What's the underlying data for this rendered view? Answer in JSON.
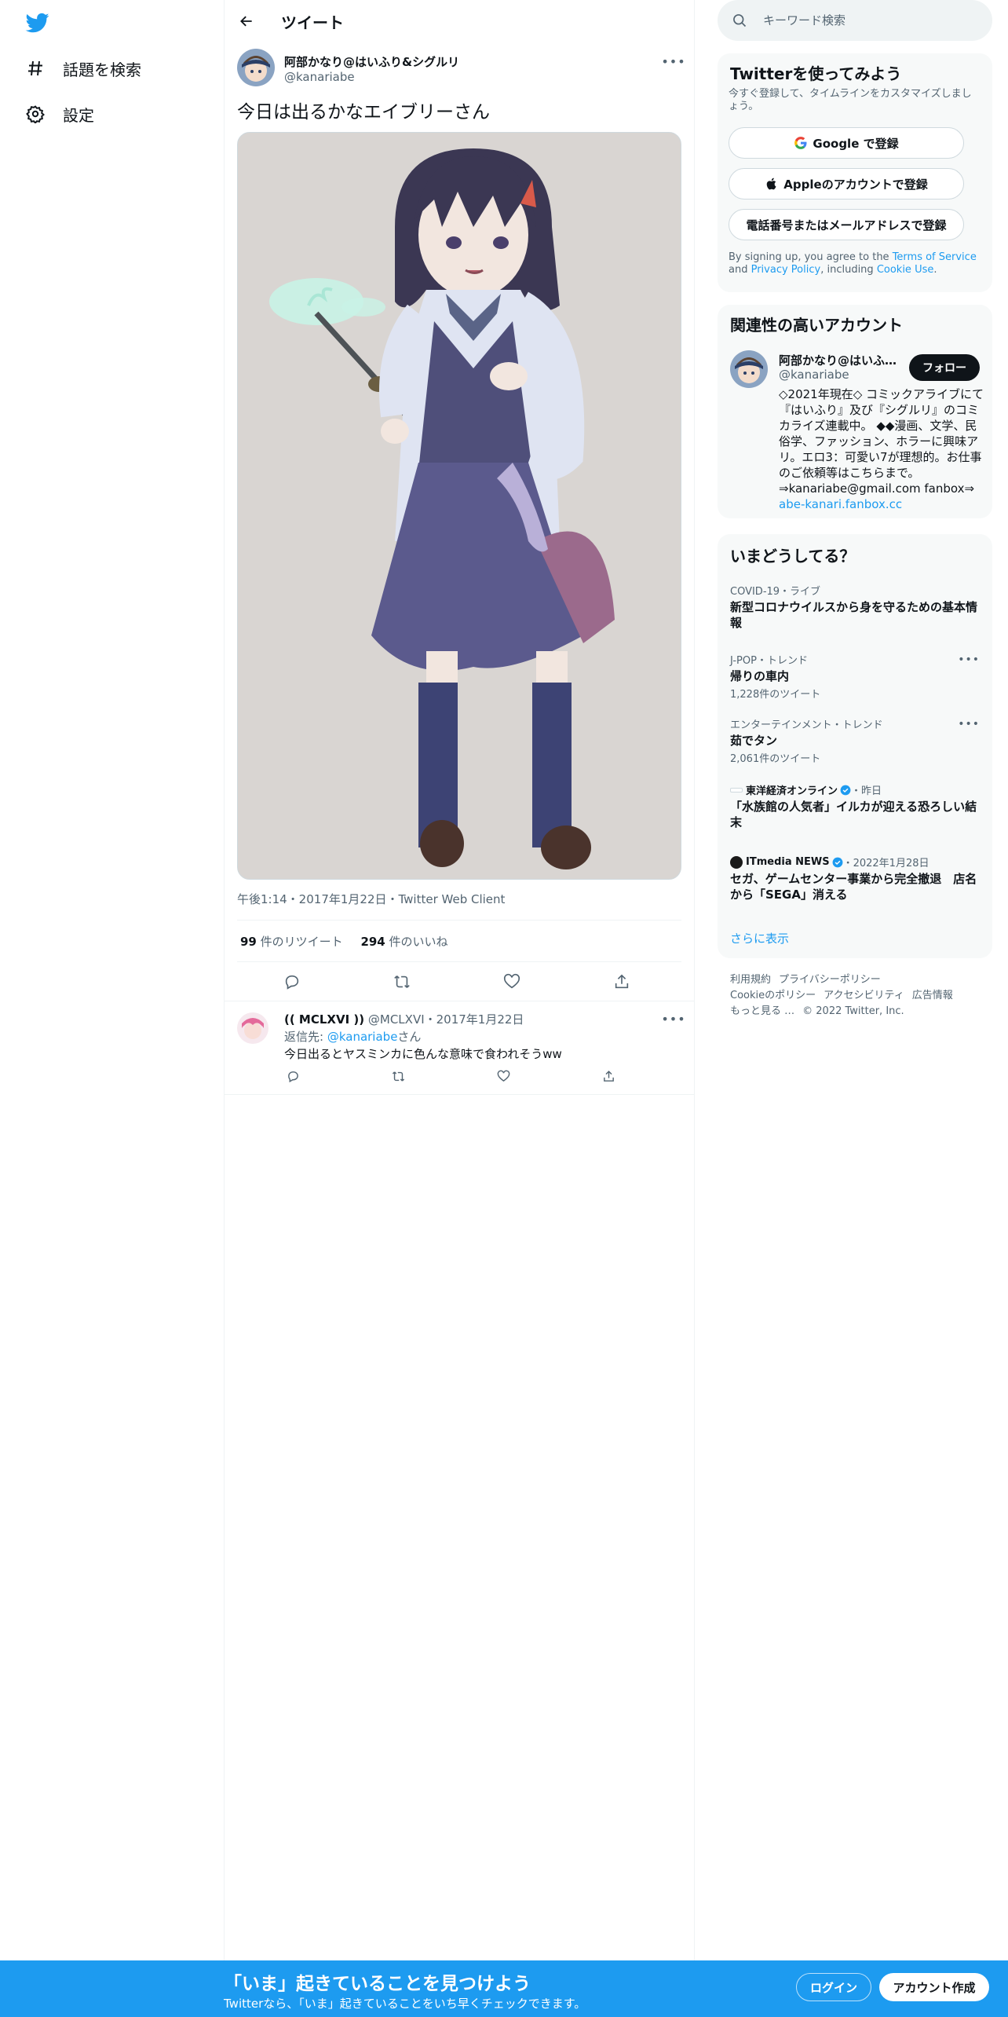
{
  "nav": {
    "logo": "twitter-bird-icon",
    "items": [
      {
        "label": "話題を検索",
        "icon": "hashtag-icon"
      },
      {
        "label": "設定",
        "icon": "gear-icon"
      }
    ]
  },
  "header": {
    "title": "ツイート"
  },
  "tweet": {
    "author_name": "阿部かなり@はいふり&シグルリ",
    "author_handle": "@kanariabe",
    "text": "今日は出るかなエイブリーさん",
    "media_alt": "illustration-of-girl-with-wand",
    "meta": "午後1:14・2017年1月22日・Twitter Web Client",
    "retweets_count": "99",
    "retweets_label": " 件のリツイート",
    "likes_count": "294",
    "likes_label": " 件のいいね"
  },
  "reply": {
    "name": "(( MCLXVI ))",
    "handle_date": " @MCLXVI・2017年1月22日",
    "to_prefix": "返信先: ",
    "to_handle": "@kanariabe",
    "to_suffix": "さん",
    "text": "今日出るとヤスミンカに色んな意味で食われそうww"
  },
  "search": {
    "placeholder": "キーワード検索"
  },
  "signup": {
    "title": "Twitterを使ってみよう",
    "desc": "今すぐ登録して、タイムラインをカスタマイズしましょう。",
    "google": "Google で登録",
    "apple": "Appleのアカウントで登録",
    "phone": "電話番号またはメールアドレスで登録",
    "terms_1": "By signing up, you agree to the ",
    "terms_tos": "Terms of Service",
    "terms_2": " and ",
    "terms_pp": "Privacy Policy",
    "terms_3": ", including ",
    "terms_cookie": "Cookie Use",
    "terms_4": "."
  },
  "related": {
    "title": "関連性の高いアカウント",
    "name": "阿部かなり@はいふり&シグルリ",
    "handle": "@kanariabe",
    "follow": "フォロー",
    "bio": "◇2021年現在◇ コミックアライブにて『はいふり』及び『シグルリ』のコミカライズ連載中。 ◆◆漫画、文学、民俗学、ファッション、ホラーに興味アリ。エロ3：可愛い7が理想的。お仕事のご依頼等はこちらまで。⇒kanariabe@gmail.com fanbox⇒",
    "bio_link": "abe-kanari.fanbox.cc"
  },
  "trends": {
    "title": "いまどうしてる？",
    "items": [
      {
        "category": "COVID-19・ライブ",
        "title": "新型コロナウイルスから身を守るための基本情報",
        "count": ""
      },
      {
        "category": "J-POP・トレンド",
        "title": "帰りの車内",
        "count": "1,228件のツイート"
      },
      {
        "category": "エンターテインメント・トレンド",
        "title": "茹でタン",
        "count": "2,061件のツイート"
      },
      {
        "source": "東洋経済オンライン",
        "when": "・昨日",
        "title": "「水族館の人気者」イルカが迎える恐ろしい結末",
        "count": ""
      },
      {
        "source": "ITmedia NEWS",
        "when": "・2022年1月28日",
        "title": "セガ、ゲームセンター事業から完全撤退　店名から「SEGA」消える",
        "count": ""
      }
    ],
    "show_more": "さらに表示"
  },
  "footer": {
    "links": [
      "利用規約",
      "プライバシーポリシー",
      "Cookieのポリシー",
      "アクセシビリティ",
      "広告情報",
      "もっと見る …",
      "© 2022 Twitter, Inc."
    ]
  },
  "bottom": {
    "title": "「いま」起きていることを見つけよう",
    "sub": "Twitterなら、「いま」起きていることをいち早くチェックできます。",
    "login": "ログイン",
    "signup": "アカウント作成"
  },
  "colors": {
    "accent": "#1d9bf0",
    "text": "#0f1419",
    "muted": "#536471",
    "card": "#f7f9f9"
  }
}
